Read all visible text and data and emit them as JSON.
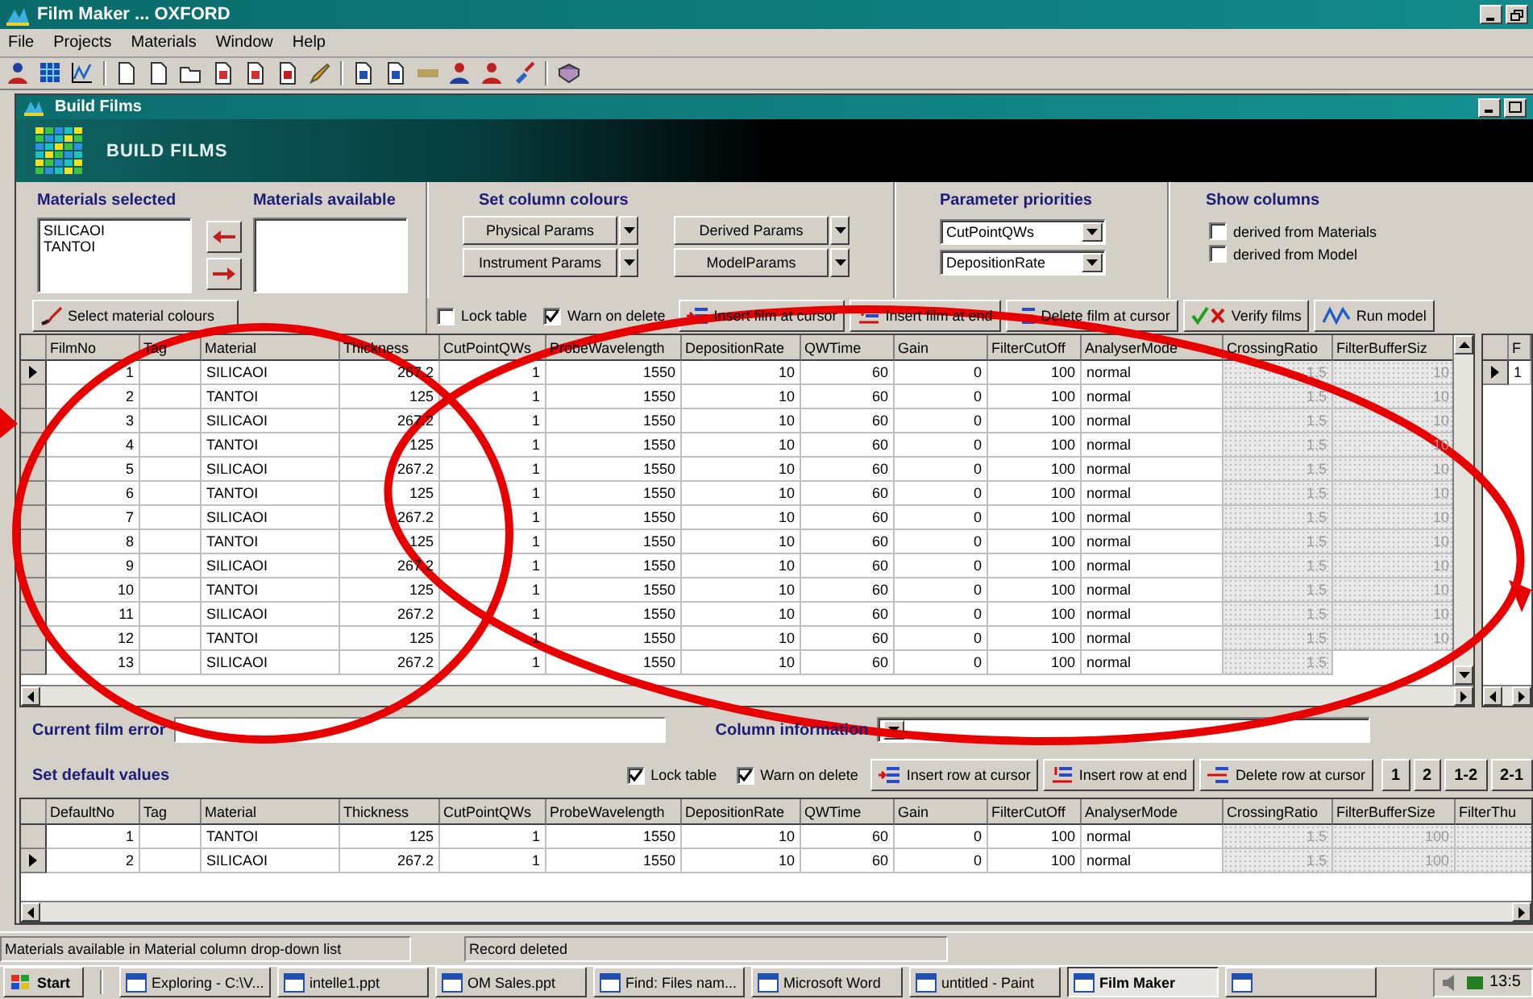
{
  "window": {
    "title": "Film Maker ... OXFORD"
  },
  "menu": [
    "File",
    "Projects",
    "Materials",
    "Window",
    "Help"
  ],
  "child_window": {
    "title": "Build Films",
    "banner": "BUILD FILMS"
  },
  "materials_selected": {
    "label": "Materials selected",
    "items": [
      "SILICAOI",
      "TANTOI"
    ]
  },
  "materials_available": {
    "label": "Materials available"
  },
  "select_colours_button": "Select material colours",
  "column_colours": {
    "label": "Set column colours",
    "buttons": [
      "Physical Params",
      "Instrument Params",
      "Derived Params",
      "ModelParams"
    ]
  },
  "parameter_priorities": {
    "label": "Parameter priorities",
    "selects": [
      "CutPointQWs",
      "DepositionRate"
    ]
  },
  "show_columns": {
    "label": "Show columns",
    "options": [
      {
        "label": "derived from Materials",
        "checked": false
      },
      {
        "label": "derived from Model",
        "checked": false
      }
    ]
  },
  "film_toolbar": {
    "checks": [
      {
        "label": "Lock table",
        "checked": false
      },
      {
        "label": "Warn on delete",
        "checked": true
      }
    ],
    "buttons": [
      {
        "label": "Insert film at cursor",
        "kind": "insert_cursor"
      },
      {
        "label": "Insert film at end",
        "kind": "insert_end"
      },
      {
        "label": "Delete film at cursor",
        "kind": "delete"
      },
      {
        "label": "Verify films",
        "kind": "verify"
      },
      {
        "label": "Run model",
        "kind": "run"
      }
    ]
  },
  "films_table": {
    "columns": [
      {
        "label": "FilmNo",
        "kind": "number"
      },
      {
        "label": "Tag",
        "kind": "text"
      },
      {
        "label": "Material",
        "kind": "text"
      },
      {
        "label": "Thickness",
        "kind": "number"
      },
      {
        "label": "CutPointQWs",
        "kind": "number"
      },
      {
        "label": "ProbeWavelength",
        "kind": "number"
      },
      {
        "label": "DepositionRate",
        "kind": "number"
      },
      {
        "label": "QWTime",
        "kind": "number"
      },
      {
        "label": "Gain",
        "kind": "number"
      },
      {
        "label": "FilterCutOff",
        "kind": "number"
      },
      {
        "label": "AnalyserMode",
        "kind": "text"
      },
      {
        "label": "CrossingRatio",
        "kind": "derived"
      },
      {
        "label": "FilterBufferSiz",
        "kind": "derived"
      }
    ],
    "rows": [
      {
        "selected": true,
        "cells": [
          "1",
          null,
          "SILICAOI",
          "267.2",
          "1",
          "1550",
          "10",
          "60",
          "0",
          "100",
          "normal",
          "1.5",
          "10"
        ]
      },
      {
        "selected": false,
        "cells": [
          "2",
          null,
          "TANTOI",
          "125",
          "1",
          "1550",
          "10",
          "60",
          "0",
          "100",
          "normal",
          "1.5",
          "10"
        ]
      },
      {
        "selected": false,
        "cells": [
          "3",
          null,
          "SILICAOI",
          "267.2",
          "1",
          "1550",
          "10",
          "60",
          "0",
          "100",
          "normal",
          "1.5",
          "10"
        ]
      },
      {
        "selected": false,
        "cells": [
          "4",
          null,
          "TANTOI",
          "125",
          "1",
          "1550",
          "10",
          "60",
          "0",
          "100",
          "normal",
          "1.5",
          "10"
        ]
      },
      {
        "selected": false,
        "cells": [
          "5",
          null,
          "SILICAOI",
          "267.2",
          "1",
          "1550",
          "10",
          "60",
          "0",
          "100",
          "normal",
          "1.5",
          "10"
        ]
      },
      {
        "selected": false,
        "cells": [
          "6",
          null,
          "TANTOI",
          "125",
          "1",
          "1550",
          "10",
          "60",
          "0",
          "100",
          "normal",
          "1.5",
          "10"
        ]
      },
      {
        "selected": false,
        "cells": [
          "7",
          null,
          "SILICAOI",
          "267.2",
          "1",
          "1550",
          "10",
          "60",
          "0",
          "100",
          "normal",
          "1.5",
          "10"
        ]
      },
      {
        "selected": false,
        "cells": [
          "8",
          null,
          "TANTOI",
          "125",
          "1",
          "1550",
          "10",
          "60",
          "0",
          "100",
          "normal",
          "1.5",
          "10"
        ]
      },
      {
        "selected": false,
        "cells": [
          "9",
          null,
          "SILICAOI",
          "267.2",
          "1",
          "1550",
          "10",
          "60",
          "0",
          "100",
          "normal",
          "1.5",
          "10"
        ]
      },
      {
        "selected": false,
        "cells": [
          "10",
          null,
          "TANTOI",
          "125",
          "1",
          "1550",
          "10",
          "60",
          "0",
          "100",
          "normal",
          "1.5",
          "10"
        ]
      },
      {
        "selected": false,
        "cells": [
          "11",
          null,
          "SILICAOI",
          "267.2",
          "1",
          "1550",
          "10",
          "60",
          "0",
          "100",
          "normal",
          "1.5",
          "10"
        ]
      },
      {
        "selected": false,
        "cells": [
          "12",
          null,
          "TANTOI",
          "125",
          "1",
          "1550",
          "10",
          "60",
          "0",
          "100",
          "normal",
          "1.5",
          "10"
        ]
      },
      {
        "selected": false,
        "cells": [
          "13",
          null,
          "SILICAOI",
          "267.2",
          "1",
          "1550",
          "10",
          "60",
          "0",
          "100",
          "normal",
          "1.5"
        ]
      }
    ]
  },
  "side_table": {
    "columns": [
      {
        "label": "F"
      }
    ],
    "rows": [
      {
        "selected": true,
        "cells": [
          "1"
        ]
      }
    ]
  },
  "current_film_error": {
    "label": "Current film error"
  },
  "column_information": {
    "label": "Column information"
  },
  "defaults": {
    "title": "Set default values",
    "checks": [
      {
        "label": "Lock table",
        "checked": true
      },
      {
        "label": "Warn on delete",
        "checked": true
      }
    ],
    "buttons": [
      {
        "label": "Insert row at cursor",
        "kind": "insert_cursor"
      },
      {
        "label": "Insert row at end",
        "kind": "insert_end"
      },
      {
        "label": "Delete row at cursor",
        "kind": "delete"
      }
    ],
    "order_buttons": [
      "1",
      "2",
      "1-2",
      "2-1"
    ],
    "table": {
      "columns": [
        {
          "label": "DefaultNo",
          "kind": "number"
        },
        {
          "label": "Tag",
          "kind": "text"
        },
        {
          "label": "Material",
          "kind": "text"
        },
        {
          "label": "Thickness",
          "kind": "number"
        },
        {
          "label": "CutPointQWs",
          "kind": "number"
        },
        {
          "label": "ProbeWavelength",
          "kind": "number"
        },
        {
          "label": "DepositionRate",
          "kind": "number"
        },
        {
          "label": "QWTime",
          "kind": "number"
        },
        {
          "label": "Gain",
          "kind": "number"
        },
        {
          "label": "FilterCutOff",
          "kind": "number"
        },
        {
          "label": "AnalyserMode",
          "kind": "text"
        },
        {
          "label": "CrossingRatio",
          "kind": "derived"
        },
        {
          "label": "FilterBufferSize",
          "kind": "derived"
        },
        {
          "label": "FilterThu",
          "kind": "derived"
        }
      ],
      "rows": [
        {
          "selected": false,
          "cells": [
            "1",
            null,
            "TANTOI",
            "125",
            "1",
            "1550",
            "10",
            "60",
            "0",
            "100",
            "normal",
            "1.5",
            "100",
            null
          ]
        },
        {
          "selected": true,
          "cells": [
            "2",
            null,
            "SILICAOI",
            "267.2",
            "1",
            "1550",
            "10",
            "60",
            "0",
            "100",
            "normal",
            "1.5",
            "100",
            null
          ]
        }
      ]
    }
  },
  "status_bar": [
    "Materials available in Material column drop-down list",
    "Record deleted"
  ],
  "taskbar": {
    "start": "Start",
    "tasks": [
      {
        "label": "Exploring - C:\\V...",
        "selected": false
      },
      {
        "label": "intelle1.ppt",
        "selected": false
      },
      {
        "label": "OM Sales.ppt",
        "selected": false
      },
      {
        "label": "Find: Files nam...",
        "selected": false
      },
      {
        "label": "Microsoft Word",
        "selected": false
      },
      {
        "label": "untitled - Paint",
        "selected": false
      },
      {
        "label": "Film Maker",
        "selected": true
      },
      {
        "selected": false
      }
    ],
    "clock": "13:5"
  }
}
